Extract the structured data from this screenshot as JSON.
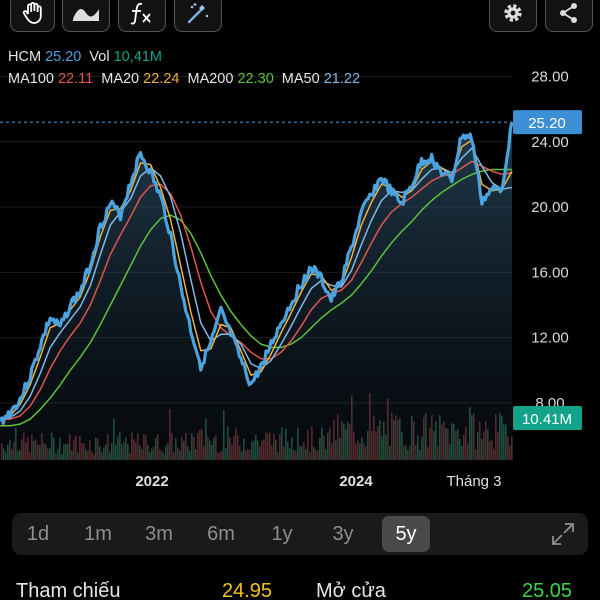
{
  "toolbar": {
    "icons": [
      "hand-pointer-icon",
      "line-style-icon",
      "function-fx-icon",
      "magic-wand-icon",
      "gear-icon",
      "share-icon"
    ]
  },
  "legend": {
    "ticker": "HCM",
    "price": "25.20",
    "vol_label": "Vol",
    "vol": "10,41M",
    "ma100_label": "MA100",
    "ma100": "22.11",
    "ma20_label": "MA20",
    "ma20": "22.24",
    "ma200_label": "MA200",
    "ma200": "22.30",
    "ma50_label": "MA50",
    "ma50": "21.22"
  },
  "colors": {
    "price": "#4aa3df",
    "ma100": "#e0564b",
    "ma20": "#f0b23a",
    "ma200": "#5cc23c",
    "ma50": "#7fb9e6",
    "vol_badge": "#12a38a",
    "price_badge": "#3c8fd4"
  },
  "chart_data": {
    "type": "line",
    "x_ticks": [
      "2022",
      "2024",
      "Tháng 3"
    ],
    "y_ticks": [
      "28.00",
      "24.00",
      "20.00",
      "16.00",
      "12.00",
      "8.00"
    ],
    "ylim": [
      4.5,
      29.5
    ],
    "current_price_label": "25.20",
    "current_volume_label": "10.41M",
    "series": [
      {
        "key": "price",
        "values": [
          6.8,
          7.4,
          8.2,
          9.6,
          11.5,
          13.2,
          12.6,
          14.0,
          14.8,
          16.5,
          18.8,
          20.2,
          19.5,
          21.5,
          23.3,
          22.1,
          20.6,
          18.3,
          15.1,
          12.5,
          10.3,
          11.6,
          13.6,
          12.2,
          10.6,
          9.1,
          10.2,
          11.6,
          12.9,
          14.1,
          15.3,
          16.3,
          15.6,
          14.3,
          15.5,
          17.5,
          19.6,
          20.8,
          21.8,
          20.9,
          20.2,
          21.3,
          22.8,
          23.0,
          22.1,
          21.6,
          24.4,
          24.2,
          20.4,
          21.0,
          21.2,
          25.2
        ]
      },
      {
        "key": "ma20",
        "values": [
          6.9,
          7.2,
          7.9,
          9.1,
          10.8,
          12.6,
          12.9,
          13.7,
          14.5,
          16.1,
          18.2,
          19.8,
          19.9,
          21.0,
          22.7,
          22.6,
          21.2,
          19.2,
          16.4,
          13.6,
          11.2,
          11.3,
          12.8,
          12.6,
          11.2,
          9.7,
          9.9,
          11.0,
          12.3,
          13.5,
          14.8,
          15.9,
          15.8,
          14.9,
          15.2,
          16.9,
          18.9,
          20.3,
          21.4,
          21.2,
          20.6,
          21.0,
          22.3,
          22.8,
          22.4,
          21.9,
          23.7,
          24.1,
          21.4,
          21.0,
          21.1,
          22.2
        ]
      },
      {
        "key": "ma50",
        "values": [
          7.0,
          7.1,
          7.5,
          8.4,
          9.8,
          11.4,
          12.3,
          13.1,
          13.9,
          15.2,
          17.1,
          18.9,
          19.7,
          20.5,
          21.9,
          22.4,
          21.9,
          20.6,
          18.4,
          15.6,
          12.9,
          11.8,
          12.2,
          12.2,
          11.6,
          10.4,
          10.1,
          10.6,
          11.6,
          12.7,
          13.9,
          15.0,
          15.5,
          15.2,
          15.1,
          16.1,
          17.7,
          19.2,
          20.4,
          21.0,
          20.9,
          21.0,
          21.7,
          22.3,
          22.4,
          22.1,
          23.0,
          23.6,
          22.5,
          21.5,
          21.1,
          21.2
        ]
      },
      {
        "key": "ma100",
        "values": [
          7.0,
          7.0,
          7.2,
          7.8,
          8.8,
          10.1,
          11.2,
          12.1,
          12.9,
          14.0,
          15.5,
          17.1,
          18.3,
          19.4,
          20.6,
          21.3,
          21.4,
          20.8,
          19.5,
          17.6,
          15.4,
          13.6,
          12.6,
          12.1,
          11.7,
          11.1,
          10.7,
          10.7,
          11.1,
          11.8,
          12.7,
          13.7,
          14.4,
          14.7,
          14.9,
          15.5,
          16.6,
          17.8,
          18.9,
          19.7,
          20.2,
          20.6,
          21.1,
          21.6,
          21.9,
          22.0,
          22.4,
          22.8,
          22.5,
          22.2,
          22.0,
          22.1
        ]
      },
      {
        "key": "ma200",
        "values": [
          6.6,
          6.6,
          6.7,
          7.0,
          7.6,
          8.3,
          9.1,
          10.0,
          10.8,
          11.7,
          12.8,
          14.0,
          15.2,
          16.4,
          17.6,
          18.6,
          19.3,
          19.5,
          19.2,
          18.4,
          17.2,
          15.8,
          14.6,
          13.6,
          12.8,
          12.1,
          11.6,
          11.4,
          11.4,
          11.6,
          12.0,
          12.6,
          13.2,
          13.7,
          14.1,
          14.6,
          15.3,
          16.1,
          17.0,
          17.8,
          18.5,
          19.1,
          19.8,
          20.4,
          20.9,
          21.3,
          21.7,
          22.0,
          22.2,
          22.3,
          22.3,
          22.3
        ]
      }
    ]
  },
  "periods": [
    "1d",
    "1m",
    "3m",
    "6m",
    "1y",
    "3y",
    "5y"
  ],
  "active_period": "5y",
  "stats": {
    "ref_label": "Tham chiếu",
    "ref_value": "24.95",
    "open_label": "Mở cửa",
    "open_value": "25.05"
  }
}
